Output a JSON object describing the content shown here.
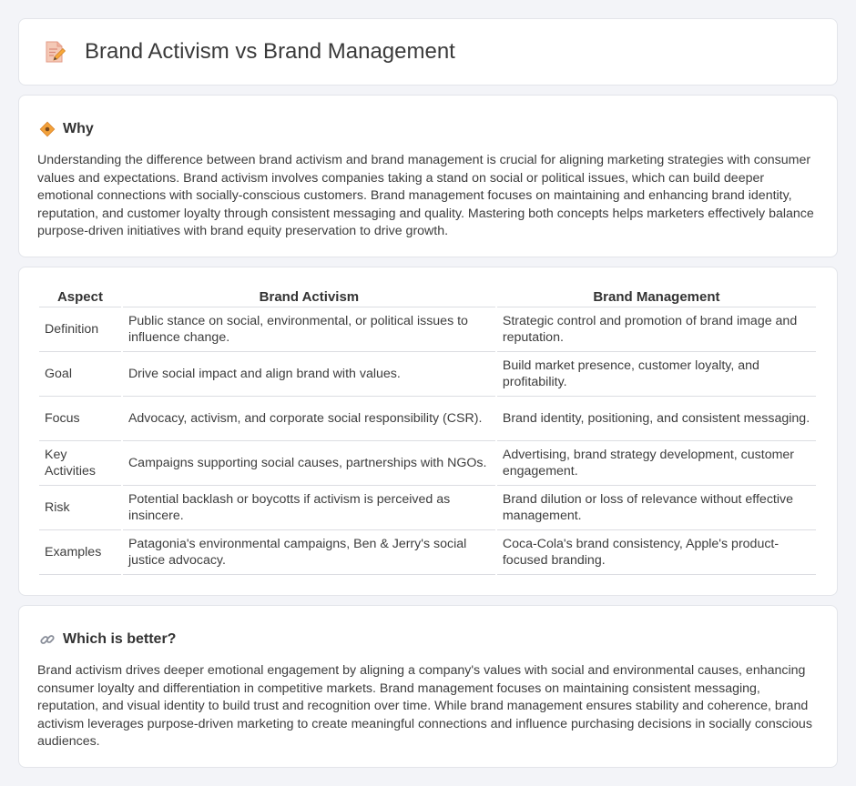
{
  "header": {
    "title": "Brand Activism vs Brand Management",
    "icon": "document-pencil-icon"
  },
  "why": {
    "icon": "diamond-sign-icon",
    "title": "Why",
    "body": "Understanding the difference between brand activism and brand management is crucial for aligning marketing strategies with consumer values and expectations. Brand activism involves companies taking a stand on social or political issues, which can build deeper emotional connections with socially-conscious customers. Brand management focuses on maintaining and enhancing brand identity, reputation, and customer loyalty through consistent messaging and quality. Mastering both concepts helps marketers effectively balance purpose-driven initiatives with brand equity preservation to drive growth."
  },
  "comparison": {
    "headers": [
      "Aspect",
      "Brand Activism",
      "Brand Management"
    ],
    "rows": [
      {
        "aspect": "Definition",
        "activism": "Public stance on social, environmental, or political issues to influence change.",
        "management": "Strategic control and promotion of brand image and reputation."
      },
      {
        "aspect": "Goal",
        "activism": "Drive social impact and align brand with values.",
        "management": "Build market presence, customer loyalty, and profitability."
      },
      {
        "aspect": "Focus",
        "activism": "Advocacy, activism, and corporate social responsibility (CSR).",
        "management": "Brand identity, positioning, and consistent messaging."
      },
      {
        "aspect": "Key Activities",
        "activism": "Campaigns supporting social causes, partnerships with NGOs.",
        "management": "Advertising, brand strategy development, customer engagement."
      },
      {
        "aspect": "Risk",
        "activism": "Potential backlash or boycotts if activism is perceived as insincere.",
        "management": "Brand dilution or loss of relevance without effective management."
      },
      {
        "aspect": "Examples",
        "activism": "Patagonia's environmental campaigns, Ben & Jerry's social justice advocacy.",
        "management": "Coca-Cola's brand consistency, Apple's product-focused branding."
      }
    ]
  },
  "better": {
    "icon": "link-icon",
    "title": "Which is better?",
    "body": "Brand activism drives deeper emotional engagement by aligning a company's values with social and environmental causes, enhancing consumer loyalty and differentiation in competitive markets. Brand management focuses on maintaining consistent messaging, reputation, and visual identity to build trust and recognition over time. While brand management ensures stability and coherence, brand activism leverages purpose-driven marketing to create meaningful connections and influence purchasing decisions in socially conscious audiences."
  }
}
